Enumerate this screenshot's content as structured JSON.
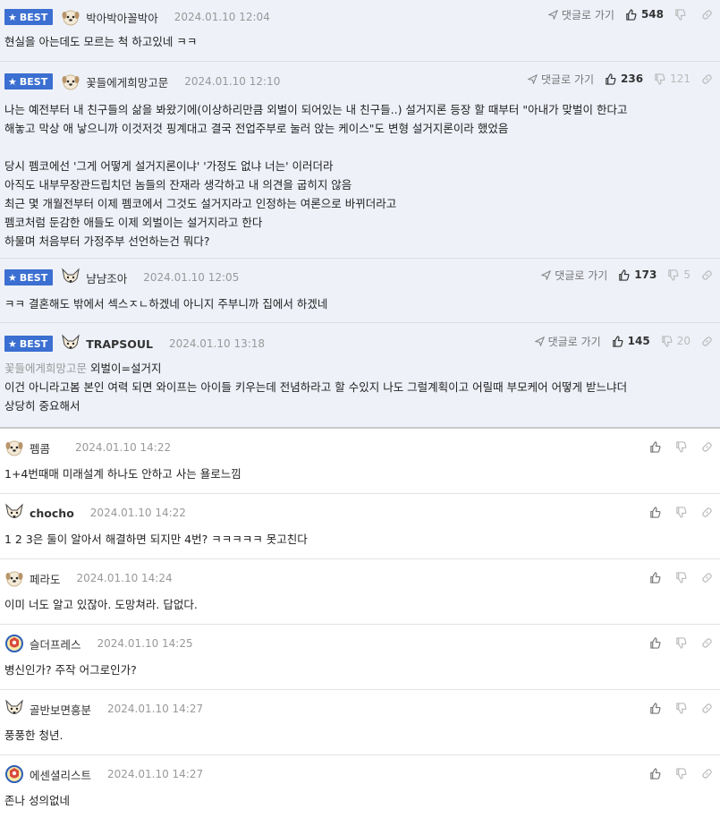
{
  "labels": {
    "best": "BEST",
    "reply": "댓글로 가기"
  },
  "colors": {
    "best_bg": "#3b6fd1",
    "best_row_bg": "#eef1f8",
    "date": "#999999"
  },
  "comments": [
    {
      "best": true,
      "avatar": "puppy-icon",
      "nick": "박아박아꼴박아",
      "date": "2024.01.10 12:04",
      "up": "548",
      "down": "",
      "body": "현실을 아는데도 모르는 척 하고있네 ㅋㅋ"
    },
    {
      "best": true,
      "avatar": "puppy-icon",
      "nick": "꽃들에게희망고문",
      "date": "2024.01.10 12:10",
      "up": "236",
      "down": "121",
      "body": "나는 예전부터 내 친구들의 삶을 봐왔기에(이상하리만큼 외벌이 되어있는 내 친구들..) 설거지론 등장 할 때부터 \"아내가 맞벌이 한다고\n해놓고 막상 애 낳으니까 이것저것 핑계대고 결국 전업주부로 눌러 앉는 케이스\"도 변형 설거지론이라 했었음\n\n당시 펨코에선 '그게 어떻게 설거지론이냐' '가정도 없냐 너는' 이러더라\n아직도 내부무장관드립치던 놈들의 잔재라 생각하고 내 의견을 굽히지 않음\n최근 몇 개월전부터 이제 펨코에서 그것도 설거지라고 인정하는 여론으로 바뀌더라고\n펨코처럼 둔감한 애들도 이제 외벌이는 설거지라고 한다\n하물며 처음부터 가정주부 선언하는건 뭐다?"
    },
    {
      "best": true,
      "avatar": "fox-icon",
      "nick": "냠냠조아",
      "date": "2024.01.10 12:05",
      "up": "173",
      "down": "5",
      "body": "ㅋㅋ 결혼해도 밖에서 섹스ㅈㄴ하겠네 아니지 주부니까 집에서 하겠네"
    },
    {
      "best": true,
      "avatar": "fox-icon",
      "nick": "TRAPSOUL",
      "nick_bold": true,
      "date": "2024.01.10 13:18",
      "up": "145",
      "down": "20",
      "quote": "꽃들에게희망고문",
      "body_after_quote": " 외벌이=설거지",
      "body": "이건 아니라고봄 본인 여력 되면 와이프는 아이들 키우는데 전념하라고 할 수있지 나도 그럴계획이고 어릴때 부모케어 어떻게 받느냐더\n상당히 중요해서"
    },
    {
      "avatar": "puppy-icon",
      "nick": "펨콤",
      "date": "2024.01.10 14:22",
      "body": "1+4번때매 미래설계 하나도 안하고 사는 욜로느낌"
    },
    {
      "avatar": "fox-icon",
      "nick": "chocho",
      "nick_bold": true,
      "date": "2024.01.10 14:22",
      "body": "1 2 3은 둘이 알아서 해결하면 되지만 4번? ㅋㅋㅋㅋㅋ 못고친다"
    },
    {
      "avatar": "puppy-icon",
      "nick": "페라도",
      "date": "2024.01.10 14:24",
      "body": "이미 너도 알고 있잖아. 도망쳐라. 답없다."
    },
    {
      "avatar": "crest-icon",
      "nick": "슬더프레스",
      "date": "2024.01.10 14:25",
      "body": "병신인가? 주작 어그로인가?"
    },
    {
      "avatar": "fox-icon",
      "nick": "골반보면흥분",
      "date": "2024.01.10 14:27",
      "body": "풍풍한 청년."
    },
    {
      "avatar": "crest-icon",
      "nick": "에센셜리스트",
      "date": "2024.01.10 14:27",
      "body": "존나 성의없네"
    }
  ]
}
